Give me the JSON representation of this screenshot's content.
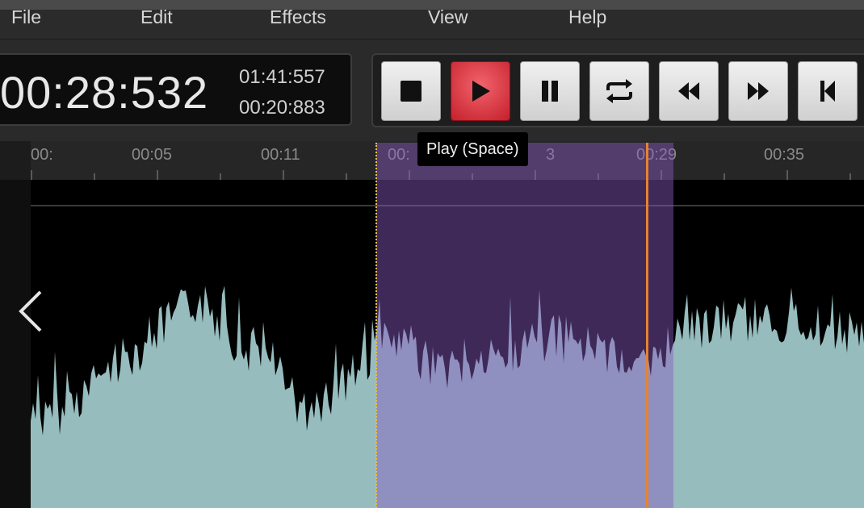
{
  "menu": {
    "file": "File",
    "edit": "Edit",
    "effects": "Effects",
    "view": "View",
    "help": "Help"
  },
  "time": {
    "current": "00:28:532",
    "duration": "01:41:557",
    "selection": "00:20:883"
  },
  "transport": {
    "buttons": [
      {
        "name": "stop",
        "icon": "stop-icon"
      },
      {
        "name": "play",
        "icon": "play-icon",
        "active": true
      },
      {
        "name": "pause",
        "icon": "pause-icon"
      },
      {
        "name": "loop",
        "icon": "loop-icon"
      },
      {
        "name": "rewind",
        "icon": "rewind-icon"
      },
      {
        "name": "fast-forward",
        "icon": "fast-forward-icon"
      },
      {
        "name": "skip-to-start",
        "icon": "skip-to-start-icon"
      }
    ],
    "tooltip": "Play (Space)"
  },
  "ruler": {
    "labels": [
      "00:",
      "00:05",
      "00:11",
      "00:",
      "3",
      "00:29",
      "00:35"
    ]
  },
  "colors": {
    "accent": "#e23340",
    "waveform": "#96bcbe",
    "selection": "#8a5cc4",
    "playhead": "#e8822e",
    "selection_start": "#e8c13c"
  }
}
